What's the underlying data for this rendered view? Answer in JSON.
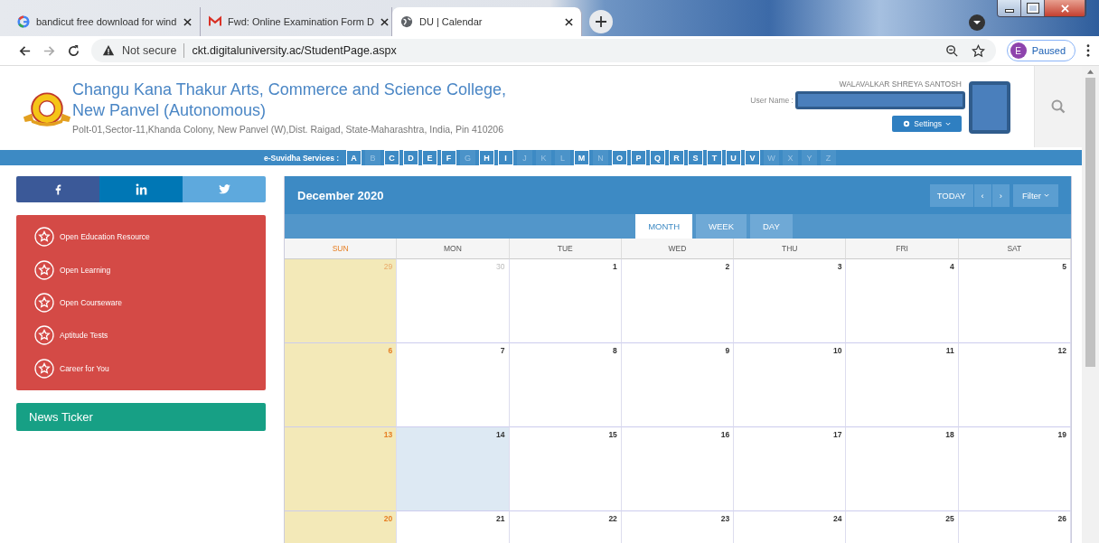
{
  "browser": {
    "tabs": [
      {
        "title": "bandicut free download for wind",
        "selected": false
      },
      {
        "title": "Fwd: Online Examination Form D",
        "selected": false
      },
      {
        "title": "DU | Calendar",
        "selected": true
      }
    ],
    "security": "Not secure",
    "url": "ckt.digitaluniversity.ac/StudentPage.aspx",
    "profile_initial": "E",
    "profile_status": "Paused"
  },
  "header": {
    "college_name": "Changu Kana Thakur Arts, Commerce and Science College, New Panvel (Autonomous)",
    "address": "Polt-01,Sector-11,Khanda Colony, New Panvel (W),Dist. Raigad, State-Maharashtra, India, Pin 410206",
    "student_name": "WALAVALKAR SHREYA SANTOSH",
    "user_label": "User Name :",
    "settings_label": "Settings"
  },
  "services": {
    "label": "e-Suvidha Services :",
    "letters": [
      {
        "letter": "A",
        "disabled": false
      },
      {
        "letter": "B",
        "disabled": true
      },
      {
        "letter": "C",
        "disabled": false
      },
      {
        "letter": "D",
        "disabled": false
      },
      {
        "letter": "E",
        "disabled": false
      },
      {
        "letter": "F",
        "disabled": false
      },
      {
        "letter": "G",
        "disabled": true
      },
      {
        "letter": "H",
        "disabled": false
      },
      {
        "letter": "I",
        "disabled": false
      },
      {
        "letter": "J",
        "disabled": true
      },
      {
        "letter": "K",
        "disabled": true
      },
      {
        "letter": "L",
        "disabled": true
      },
      {
        "letter": "M",
        "disabled": false
      },
      {
        "letter": "N",
        "disabled": true
      },
      {
        "letter": "O",
        "disabled": false
      },
      {
        "letter": "P",
        "disabled": false
      },
      {
        "letter": "Q",
        "disabled": false
      },
      {
        "letter": "R",
        "disabled": false
      },
      {
        "letter": "S",
        "disabled": false
      },
      {
        "letter": "T",
        "disabled": false
      },
      {
        "letter": "U",
        "disabled": false
      },
      {
        "letter": "V",
        "disabled": false
      },
      {
        "letter": "W",
        "disabled": true
      },
      {
        "letter": "X",
        "disabled": true
      },
      {
        "letter": "Y",
        "disabled": true
      },
      {
        "letter": "Z",
        "disabled": true
      }
    ]
  },
  "social": [
    {
      "kind": "facebook"
    },
    {
      "kind": "linkedin"
    },
    {
      "kind": "twitter"
    }
  ],
  "sidebar": {
    "items": [
      "Open Education Resource",
      "Open Learning",
      "Open Courseware",
      "Aptitude Tests",
      "Career for You"
    ],
    "news_title": "News Ticker"
  },
  "calendar": {
    "title": "December 2020",
    "today_label": "TODAY",
    "prev": "‹",
    "next": "›",
    "filter_label": "Filter",
    "views": [
      {
        "label": "MONTH",
        "selected": true
      },
      {
        "label": "WEEK",
        "selected": false
      },
      {
        "label": "DAY",
        "selected": false
      }
    ],
    "weekdays": [
      "SUN",
      "MON",
      "TUE",
      "WED",
      "THU",
      "FRI",
      "SAT"
    ],
    "weeks": [
      [
        {
          "day": "29",
          "other_month": true,
          "today": false
        },
        {
          "day": "30",
          "other_month": true,
          "today": false
        },
        {
          "day": "1",
          "other_month": false,
          "today": false
        },
        {
          "day": "2",
          "other_month": false,
          "today": false
        },
        {
          "day": "3",
          "other_month": false,
          "today": false
        },
        {
          "day": "4",
          "other_month": false,
          "today": false
        },
        {
          "day": "5",
          "other_month": false,
          "today": false
        }
      ],
      [
        {
          "day": "6",
          "other_month": false,
          "today": false
        },
        {
          "day": "7",
          "other_month": false,
          "today": false
        },
        {
          "day": "8",
          "other_month": false,
          "today": false
        },
        {
          "day": "9",
          "other_month": false,
          "today": false
        },
        {
          "day": "10",
          "other_month": false,
          "today": false
        },
        {
          "day": "11",
          "other_month": false,
          "today": false
        },
        {
          "day": "12",
          "other_month": false,
          "today": false
        }
      ],
      [
        {
          "day": "13",
          "other_month": false,
          "today": false
        },
        {
          "day": "14",
          "other_month": false,
          "today": true
        },
        {
          "day": "15",
          "other_month": false,
          "today": false
        },
        {
          "day": "16",
          "other_month": false,
          "today": false
        },
        {
          "day": "17",
          "other_month": false,
          "today": false
        },
        {
          "day": "18",
          "other_month": false,
          "today": false
        },
        {
          "day": "19",
          "other_month": false,
          "today": false
        }
      ],
      [
        {
          "day": "20",
          "other_month": false,
          "today": false
        },
        {
          "day": "21",
          "other_month": false,
          "today": false
        },
        {
          "day": "22",
          "other_month": false,
          "today": false
        },
        {
          "day": "23",
          "other_month": false,
          "today": false
        },
        {
          "day": "24",
          "other_month": false,
          "today": false
        },
        {
          "day": "25",
          "other_month": false,
          "today": false
        },
        {
          "day": "26",
          "other_month": false,
          "today": false
        }
      ]
    ]
  }
}
